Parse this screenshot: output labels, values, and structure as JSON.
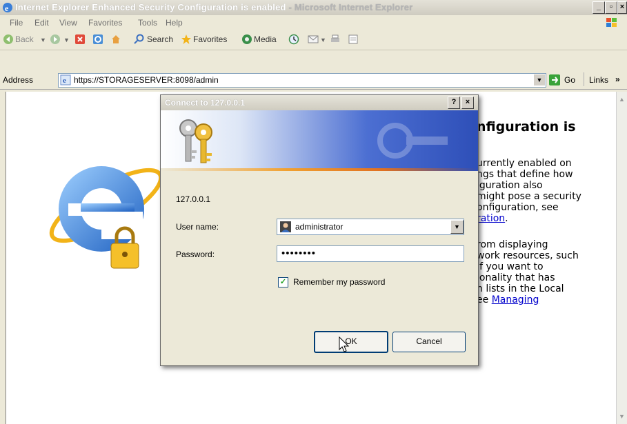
{
  "window": {
    "title_bold": "Internet Explorer Enhanced Security Configuration is enabled",
    "title_rest": " - Microsoft Internet Explorer",
    "min_label": "_",
    "max_label": "▫",
    "close_label": "×"
  },
  "menu": [
    "File",
    "Edit",
    "View",
    "Favorites",
    "Tools",
    "Help"
  ],
  "toolbar": {
    "back": "Back",
    "search": "Search",
    "favorites": "Favorites",
    "media": "Media"
  },
  "address": {
    "label": "Address",
    "url": "https://STORAGESERVER:8098/admin",
    "go": "Go",
    "links": "Links"
  },
  "page": {
    "heading_partial": "nfiguration is",
    "para1": [
      "urrently enabled on",
      "ngs that define how",
      "iguration also",
      "might pose a security",
      "onfiguration, see"
    ],
    "para1_link": "ration",
    "para1_end": ".",
    "para2": [
      "rom displaying",
      "work resources, such",
      "If you want to",
      "ionality that has",
      "n lists in the Local"
    ],
    "para2_prefix": "ee",
    "para2_link": "Managing"
  },
  "dialog": {
    "title": "Connect to 127.0.0.1",
    "help_label": "?",
    "close_label": "×",
    "server": "127.0.0.1",
    "username_label": "User name:",
    "username_value": "administrator",
    "password_label": "Password:",
    "password_value": "••••••••",
    "remember_label": "Remember my password",
    "remember_checked": "✓",
    "ok_label": "OK",
    "cancel_label": "Cancel"
  }
}
